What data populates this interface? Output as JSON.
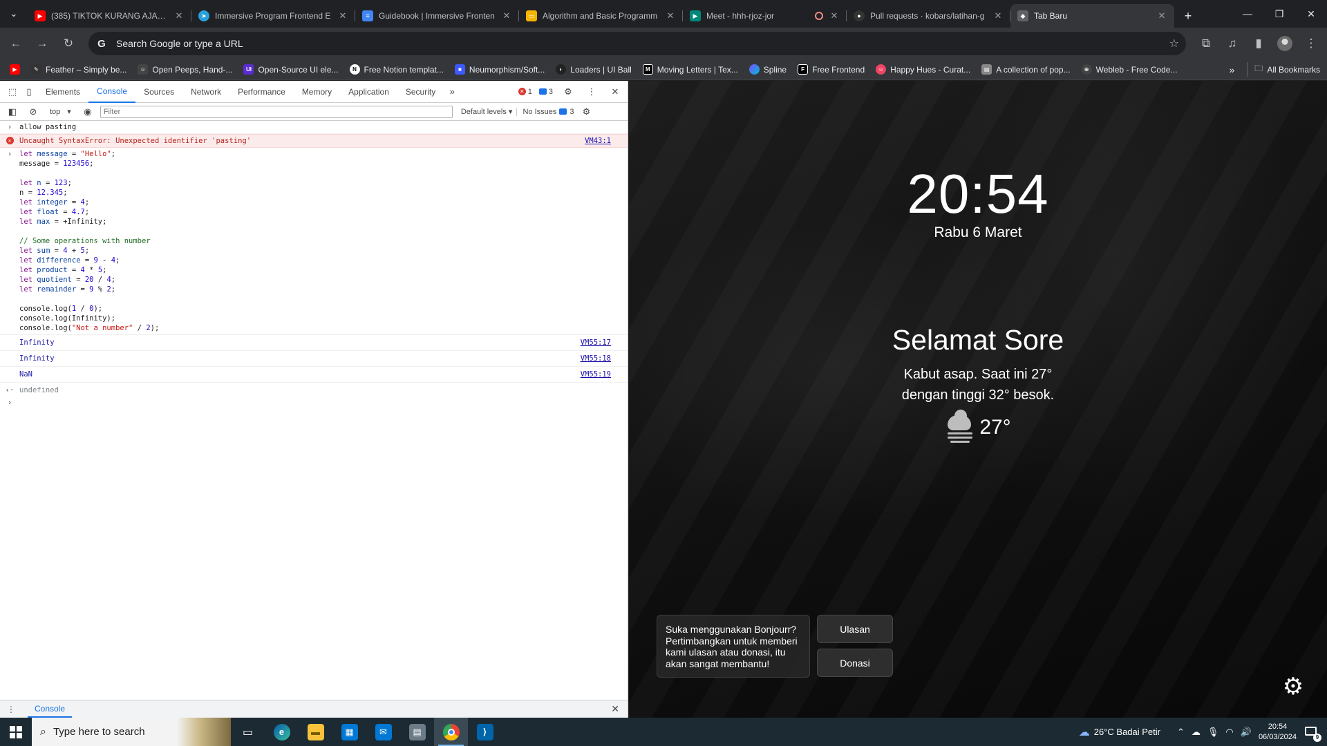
{
  "browser": {
    "tabs": [
      {
        "title": "(385) TIKTOK KURANG AJAR KE",
        "favicon_color": "#ff0000",
        "favicon_glyph": "▶"
      },
      {
        "title": "Immersive Program Frontend E",
        "favicon_color": "#2aa1da",
        "favicon_glyph": "➤"
      },
      {
        "title": "Guidebook | Immersive Fronten",
        "favicon_color": "#4285f4",
        "favicon_glyph": "≡"
      },
      {
        "title": "Algorithm and Basic Programm",
        "favicon_color": "#f4b400",
        "favicon_glyph": "▭"
      },
      {
        "title": "Meet - hhh-rjoz-jor",
        "favicon_color": "#00897b",
        "favicon_glyph": "▶",
        "recording": true
      },
      {
        "title": "Pull requests · kobars/latihan-g",
        "favicon_color": "#333333",
        "favicon_glyph": "●"
      },
      {
        "title": "Tab Baru",
        "favicon_color": "#5f6368",
        "favicon_glyph": "◆",
        "active": true
      }
    ],
    "omnibox_placeholder": "Search Google or type a URL",
    "bookmarks": [
      {
        "label": "",
        "color": "#ff0000",
        "glyph": "▶"
      },
      {
        "label": "Feather – Simply be...",
        "color": "#333333",
        "glyph": "✎"
      },
      {
        "label": "Open Peeps, Hand-...",
        "color": "#444444",
        "glyph": "☺"
      },
      {
        "label": "Open-Source UI ele...",
        "color": "#5b2dd1",
        "glyph": "UI"
      },
      {
        "label": "Free Notion templat...",
        "color": "#ffffff",
        "glyph": "N"
      },
      {
        "label": "Neumorphism/Soft...",
        "color": "#3d5afe",
        "glyph": "■"
      },
      {
        "label": "Loaders | UI Ball",
        "color": "#222222",
        "glyph": "◐"
      },
      {
        "label": "Moving Letters | Tex...",
        "color": "#000000",
        "glyph": "M"
      },
      {
        "label": "Spline",
        "color": "#7c4dff",
        "glyph": "●"
      },
      {
        "label": "Free Frontend",
        "color": "#000000",
        "glyph": "F"
      },
      {
        "label": "Happy Hues - Curat...",
        "color": "#ef4565",
        "glyph": "☺"
      },
      {
        "label": "A collection of pop...",
        "color": "#888888",
        "glyph": "▤"
      },
      {
        "label": "Webleb - Free Code...",
        "color": "#444444",
        "glyph": "⊕"
      }
    ],
    "all_bookmarks": "All Bookmarks"
  },
  "devtools": {
    "tabs": [
      "Elements",
      "Console",
      "Sources",
      "Network",
      "Performance",
      "Memory",
      "Application",
      "Security"
    ],
    "active_tab": "Console",
    "error_count": "1",
    "message_count": "3",
    "context": "top",
    "filter_placeholder": "Filter",
    "levels": "Default levels",
    "issues": "No Issues",
    "issues_count": "3",
    "drawer_tab": "Console",
    "console": {
      "first_input": "allow pasting",
      "error_text": "Uncaught SyntaxError: Unexpected identifier 'pasting'",
      "error_src": "VM43:1",
      "outputs": [
        {
          "value": "Infinity",
          "src": "VM55:17"
        },
        {
          "value": "Infinity",
          "src": "VM55:18"
        },
        {
          "value": "NaN",
          "src": "VM55:19"
        }
      ],
      "return_value": "undefined"
    }
  },
  "newtab": {
    "clock": "20:54",
    "date": "Rabu 6 Maret",
    "greeting": "Selamat Sore",
    "weather_line1": "Kabut asap. Saat ini 27°",
    "weather_line2": "dengan tinggi 32° besok.",
    "temperature": "27°",
    "support_text": "Suka menggunakan Bonjourr? Pertimbangkan untuk memberi kami ulasan atau donasi, itu akan sangat membantu!",
    "review_button": "Ulasan",
    "donate_button": "Donasi"
  },
  "taskbar": {
    "search_placeholder": "Type here to search",
    "weather": "26°C  Badai Petir",
    "time": "20:54",
    "date": "06/03/2024",
    "notifications": "9"
  }
}
